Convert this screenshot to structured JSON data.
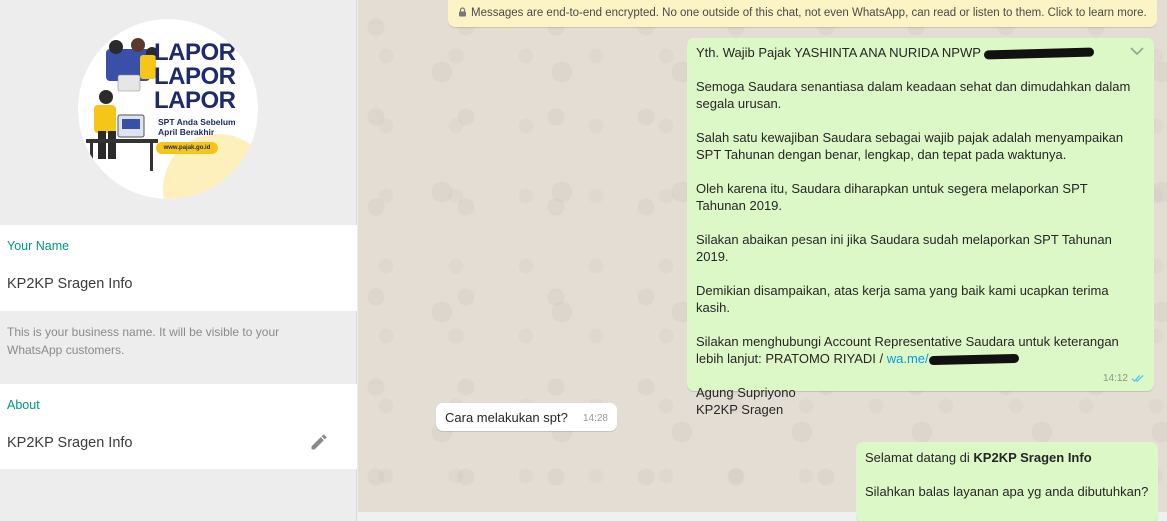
{
  "profile": {
    "poster": {
      "headline_1": "LAPOR",
      "headline_2": "LAPOR",
      "headline_3": "LAPOR",
      "sub_1": "SPT Anda Sebelum",
      "sub_2": "April Berakhir",
      "url": "www.pajak.go.id"
    },
    "name_label": "Your Name",
    "name_value": "KP2KP Sragen Info",
    "name_hint": "This is your business name. It will be visible to your WhatsApp customers.",
    "about_label": "About",
    "about_value": "KP2KP Sragen Info",
    "edit_icon": "pencil-icon"
  },
  "chat": {
    "encryption_notice": "Messages are end-to-end encrypted. No one outside of this chat, not even WhatsApp, can read or listen to them. Click to learn more.",
    "messages": [
      {
        "direction": "outgoing",
        "line_1": "Yth. Wajib Pajak YASHINTA ANA NURIDA NPWP",
        "line_2": "Semoga Saudara senantiasa dalam keadaan sehat dan dimudahkan dalam segala urusan.",
        "line_3": "Salah satu kewajiban Saudara sebagai wajib pajak adalah menyampaikan SPT Tahunan dengan benar, lengkap, dan tepat pada waktunya.",
        "line_4": "Oleh karena itu, Saudara diharapkan untuk segera melaporkan SPT Tahunan 2019.",
        "line_5": "Silakan abaikan pesan ini jika Saudara sudah melaporkan SPT Tahunan 2019.",
        "line_6": "Demikian disampaikan, atas kerja sama yang baik kami ucapkan terima kasih.",
        "line_7": "Silakan menghubungi Account Representative Saudara untuk keterangan lebih lanjut: PRATOMO RIYADI / ",
        "link": "wa.me/",
        "sign_1": "Agung Supriyono",
        "sign_2": "KP2KP Sragen",
        "time": "14:12",
        "status_icon": "double-check-icon"
      },
      {
        "direction": "incoming",
        "text": "Cara melakukan spt?",
        "time": "14:28"
      },
      {
        "direction": "outgoing",
        "text_pre": "Selamat datang di ",
        "text_bold": "KP2KP Sragen Info",
        "text_2": "Silahkan balas layanan apa yg anda dibutuhkan?"
      }
    ]
  },
  "colors": {
    "accent": "#009688",
    "outgoing_bubble": "#dcf8c6",
    "incoming_bubble": "#ffffff",
    "chat_bg": "#e4ddd4",
    "notice_bg": "#fcf4c4",
    "link": "#039be5"
  }
}
